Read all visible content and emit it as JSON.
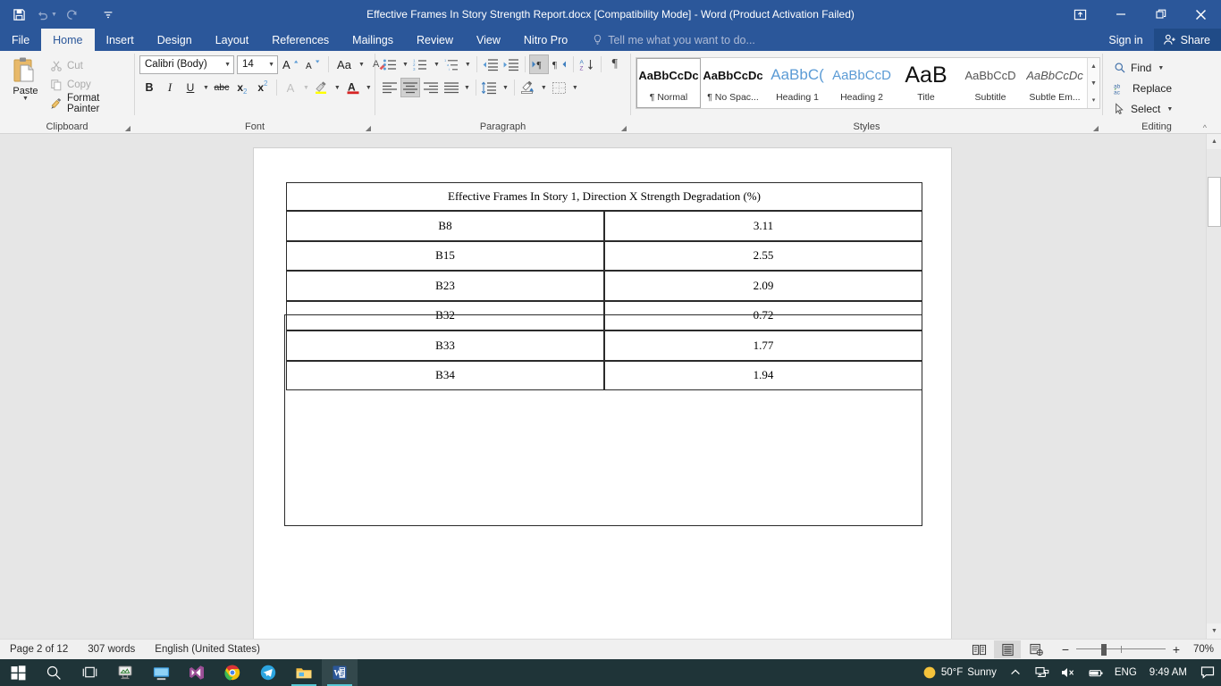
{
  "window": {
    "title": "Effective Frames In Story Strength Report.docx [Compatibility Mode] - Word (Product Activation Failed)",
    "quick_access": [
      {
        "name": "save-icon",
        "label": "Save"
      },
      {
        "name": "undo-icon",
        "label": "Undo"
      },
      {
        "name": "redo-icon",
        "label": "Redo"
      },
      {
        "name": "customize-qat-icon",
        "label": "Customize Quick Access Toolbar"
      }
    ],
    "controls": [
      {
        "name": "ribbon-display-options-button",
        "label": "Ribbon Display Options"
      },
      {
        "name": "minimize-button",
        "label": "Minimize"
      },
      {
        "name": "restore-button",
        "label": "Restore Down"
      },
      {
        "name": "close-button",
        "label": "Close"
      }
    ]
  },
  "tabs": [
    {
      "label": "File",
      "active": false
    },
    {
      "label": "Home",
      "active": true
    },
    {
      "label": "Insert",
      "active": false
    },
    {
      "label": "Design",
      "active": false
    },
    {
      "label": "Layout",
      "active": false
    },
    {
      "label": "References",
      "active": false
    },
    {
      "label": "Mailings",
      "active": false
    },
    {
      "label": "Review",
      "active": false
    },
    {
      "label": "View",
      "active": false
    },
    {
      "label": "Nitro Pro",
      "active": false
    }
  ],
  "tell_me": {
    "placeholder": "Tell me what you want to do..."
  },
  "account": {
    "sign_in": "Sign in",
    "share": "Share"
  },
  "ribbon": {
    "clipboard": {
      "group_label": "Clipboard",
      "paste_label": "Paste",
      "commands": [
        {
          "label": "Cut",
          "icon": "scissors-icon",
          "enabled": false
        },
        {
          "label": "Copy",
          "icon": "copy-icon",
          "enabled": false
        },
        {
          "label": "Format Painter",
          "icon": "format-painter-icon",
          "enabled": true
        }
      ]
    },
    "font": {
      "group_label": "Font",
      "font_name": "Calibri (Body)",
      "font_size": "14",
      "buttons_row1": [
        {
          "label": "A",
          "name": "increase-font-size-button"
        },
        {
          "label": "A",
          "name": "decrease-font-size-button"
        },
        {
          "label": "Aa",
          "name": "change-case-button"
        },
        {
          "label": "",
          "name": "clear-formatting-icon"
        }
      ],
      "buttons_row2": [
        {
          "label": "B",
          "name": "bold-button"
        },
        {
          "label": "I",
          "name": "italic-button"
        },
        {
          "label": "U",
          "name": "underline-button"
        },
        {
          "label": "abc",
          "name": "strikethrough-button"
        },
        {
          "label": "x",
          "name": "subscript-button"
        },
        {
          "label": "x",
          "name": "superscript-button"
        },
        {
          "label": "A",
          "name": "text-effects-button"
        },
        {
          "label": "",
          "name": "text-highlight-color-button"
        },
        {
          "label": "A",
          "name": "font-color-button"
        }
      ]
    },
    "paragraph": {
      "group_label": "Paragraph",
      "row1": [
        {
          "name": "bullets-button"
        },
        {
          "name": "numbering-button"
        },
        {
          "name": "multilevel-list-button"
        },
        {
          "name": "decrease-indent-button"
        },
        {
          "name": "increase-indent-button"
        },
        {
          "name": "left-to-right-text-direction-button",
          "active": true
        },
        {
          "name": "right-to-left-text-direction-button"
        },
        {
          "name": "sort-button"
        },
        {
          "name": "show-formatting-marks-button"
        }
      ],
      "row2": [
        {
          "name": "align-left-button"
        },
        {
          "name": "align-center-button",
          "active": true
        },
        {
          "name": "align-right-button"
        },
        {
          "name": "justify-button"
        },
        {
          "name": "line-and-paragraph-spacing-button"
        },
        {
          "name": "shading-button"
        },
        {
          "name": "borders-button"
        }
      ]
    },
    "styles": {
      "group_label": "Styles",
      "items": [
        {
          "preview": "AaBbCcDc",
          "name": "¶ Normal",
          "selected": true,
          "color": "#111111",
          "weight": "600",
          "size": "13px",
          "style": "normal"
        },
        {
          "preview": "AaBbCcDc",
          "name": "¶ No Spac...",
          "selected": false,
          "color": "#111111",
          "weight": "600",
          "size": "13px",
          "style": "normal"
        },
        {
          "preview": "AaBbC(",
          "name": "Heading 1",
          "selected": false,
          "color": "#5b9bd5",
          "weight": "400",
          "size": "17px",
          "style": "normal"
        },
        {
          "preview": "AaBbCcD",
          "name": "Heading 2",
          "selected": false,
          "color": "#5b9bd5",
          "weight": "400",
          "size": "15px",
          "style": "normal"
        },
        {
          "preview": "AaB",
          "name": "Title",
          "selected": false,
          "color": "#111111",
          "weight": "300",
          "size": "24px",
          "style": "normal"
        },
        {
          "preview": "AaBbCcD",
          "name": "Subtitle",
          "selected": false,
          "color": "#444444",
          "weight": "400",
          "size": "13px",
          "style": "normal"
        },
        {
          "preview": "AaBbCcDc",
          "name": "Subtle Em...",
          "selected": false,
          "color": "#444444",
          "weight": "400",
          "size": "13px",
          "style": "italic"
        }
      ]
    },
    "editing": {
      "group_label": "Editing",
      "commands": [
        {
          "label": "Find",
          "icon": "magnifier-icon",
          "has_caret": true
        },
        {
          "label": "Replace",
          "icon": "replace-icon",
          "has_caret": false
        },
        {
          "label": "Select",
          "icon": "cursor-select-icon",
          "has_caret": true
        }
      ],
      "collapse_label": "Collapse the Ribbon"
    }
  },
  "document": {
    "table": {
      "title": "Effective Frames In Story 1, Direction X Strength Degradation (%)",
      "rows": [
        {
          "frame": "B8",
          "value": "3.11"
        },
        {
          "frame": "B15",
          "value": "2.55"
        },
        {
          "frame": "B23",
          "value": "2.09"
        },
        {
          "frame": "B32",
          "value": "0.72"
        },
        {
          "frame": "B33",
          "value": "1.77"
        },
        {
          "frame": "B34",
          "value": "1.94"
        }
      ]
    }
  },
  "status_bar": {
    "page": "Page 2 of 12",
    "words": "307 words",
    "language": "English (United States)",
    "views": [
      {
        "name": "read-mode-view-button",
        "label": "Read Mode",
        "active": false
      },
      {
        "name": "print-layout-view-button",
        "label": "Print Layout",
        "active": true
      },
      {
        "name": "web-layout-view-button",
        "label": "Web Layout",
        "active": false
      }
    ],
    "zoom_out": "−",
    "zoom_in": "+",
    "zoom_level": "70%"
  },
  "taskbar": {
    "items": [
      {
        "name": "start-button",
        "label": "Start",
        "running": false,
        "active": false
      },
      {
        "name": "search-icon",
        "label": "Search",
        "running": false,
        "active": false
      },
      {
        "name": "task-view-icon",
        "label": "Task View",
        "running": false,
        "active": false
      },
      {
        "name": "etabs-icon",
        "label": "ETABS",
        "running": false,
        "active": false
      },
      {
        "name": "remote-desktop-icon",
        "label": "Remote Desktop",
        "running": false,
        "active": false
      },
      {
        "name": "visual-studio-icon",
        "label": "Visual Studio",
        "running": false,
        "active": false
      },
      {
        "name": "chrome-icon",
        "label": "Google Chrome",
        "running": false,
        "active": false
      },
      {
        "name": "telegram-icon",
        "label": "Telegram",
        "running": false,
        "active": false
      },
      {
        "name": "file-explorer-icon",
        "label": "File Explorer",
        "running": true,
        "active": false
      },
      {
        "name": "word-icon",
        "label": "Microsoft Word",
        "running": true,
        "active": true
      }
    ],
    "tray": {
      "weather_temp": "50°F",
      "weather_desc": "Sunny",
      "show_hidden": "∧",
      "network": "network-icon",
      "volume": "volume-muted-icon",
      "battery": "battery-icon",
      "language": "ENG",
      "clock": "9:49 AM",
      "action_center": "action-center-icon"
    }
  },
  "colors": {
    "ribbon_blue": "#2B579A",
    "share_blue": "#204b87",
    "ribbon_bg": "#f3f3f3",
    "doc_bg": "#e6e6e6",
    "taskbar": "#1f3438",
    "accent_teal": "#57c7d4"
  }
}
